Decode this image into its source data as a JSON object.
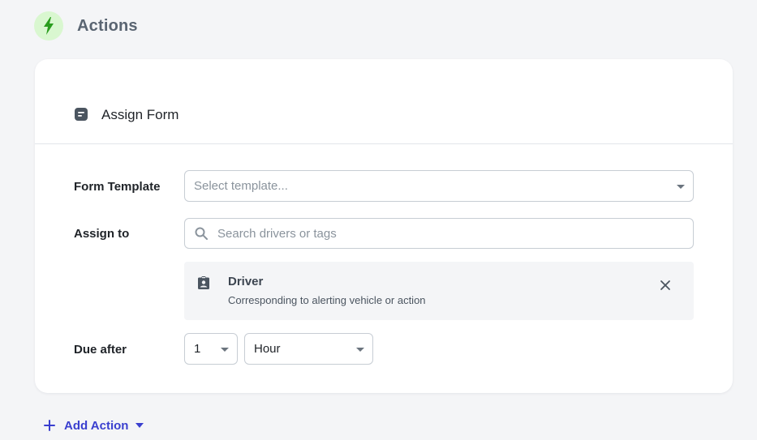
{
  "section": {
    "title": "Actions",
    "icon": "bolt-icon",
    "accent": "#2a9d1e"
  },
  "card": {
    "title": "Assign Form",
    "icon": "form-icon"
  },
  "fields": {
    "form_template": {
      "label": "Form Template",
      "placeholder": "Select template..."
    },
    "assign_to": {
      "label": "Assign to",
      "placeholder": "Search drivers or tags"
    },
    "due_after": {
      "label": "Due after",
      "amount": "1",
      "unit": "Hour"
    }
  },
  "assignee": {
    "name": "Driver",
    "description": "Corresponding to alerting vehicle or action",
    "icon": "id-badge-icon"
  },
  "add_action": {
    "label": "Add Action",
    "color": "#3a3fcf"
  }
}
